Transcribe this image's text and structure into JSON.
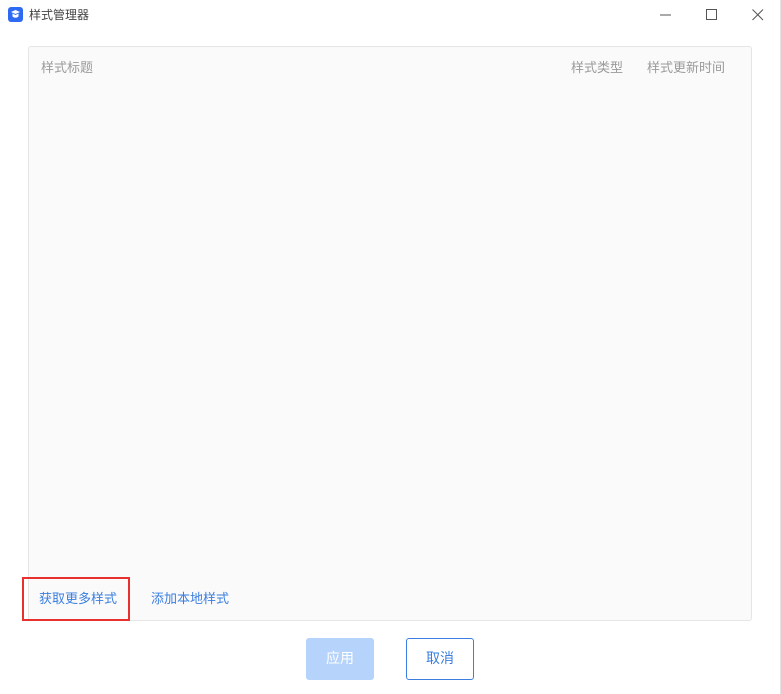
{
  "window": {
    "title": "样式管理器",
    "icon": "app-logo-icon",
    "controls": {
      "minimize": "minimize-icon",
      "maximize": "maximize-icon",
      "close": "close-icon"
    }
  },
  "style_list": {
    "columns": {
      "title": "样式标题",
      "type": "样式类型",
      "updated": "样式更新时间"
    },
    "rows": []
  },
  "actions": {
    "get_more": "获取更多样式",
    "add_local": "添加本地样式"
  },
  "footer": {
    "apply_label": "应用",
    "apply_enabled": false,
    "cancel_label": "取消"
  },
  "colors": {
    "accent": "#3b7ee0",
    "apply_disabled_bg": "#b6d3fb",
    "highlight": "#e8312f",
    "app_icon": "#2f6bf2"
  }
}
